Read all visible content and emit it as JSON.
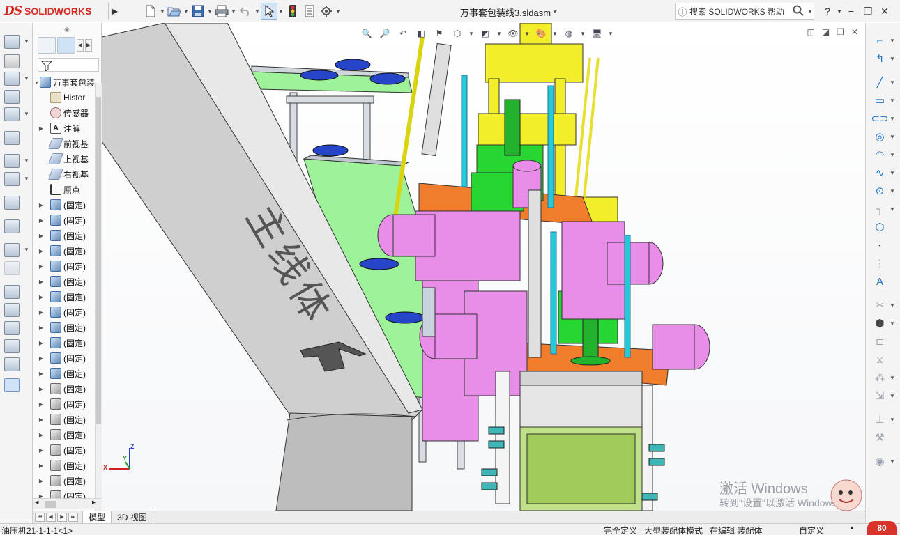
{
  "app": {
    "logo_text": "SOLIDWORKS",
    "logo_ds": "DS",
    "document_title": "万事套包装线3.sldasm *",
    "search_placeholder": "搜索 SOLIDWORKS 帮助",
    "help_label": "?",
    "expand_arrow": "▶"
  },
  "toolbar": {
    "icons": [
      "new-document-icon",
      "open-icon",
      "save-icon",
      "print-icon",
      "undo-icon",
      "select-icon",
      "rebuild-traffic-light-icon",
      "file-properties-icon",
      "options-gear-icon"
    ]
  },
  "feature_tree": {
    "root_label": "万事套包装",
    "items": [
      {
        "label": "Histor",
        "icon": "history-icon",
        "expand": ""
      },
      {
        "label": "传感器",
        "icon": "sensor-icon",
        "expand": ""
      },
      {
        "label": "注解",
        "icon": "annotation-icon",
        "expand": "▶"
      },
      {
        "label": "前视基",
        "icon": "plane-icon",
        "expand": ""
      },
      {
        "label": "上视基",
        "icon": "plane-icon",
        "expand": ""
      },
      {
        "label": "右视基",
        "icon": "plane-icon",
        "expand": ""
      },
      {
        "label": "原点",
        "icon": "origin-icon",
        "expand": ""
      },
      {
        "label": "(固定)",
        "icon": "part-icon",
        "expand": "▶"
      },
      {
        "label": "(固定)",
        "icon": "part-icon",
        "expand": "▶"
      },
      {
        "label": "(固定)",
        "icon": "part-icon",
        "expand": "▶"
      },
      {
        "label": "(固定)",
        "icon": "part-icon",
        "expand": "▶"
      },
      {
        "label": "(固定)",
        "icon": "part-icon",
        "expand": "▶"
      },
      {
        "label": "(固定)",
        "icon": "part-icon",
        "expand": "▶"
      },
      {
        "label": "(固定)",
        "icon": "part-icon",
        "expand": "▶"
      },
      {
        "label": "(固定)",
        "icon": "part-icon",
        "expand": "▶"
      },
      {
        "label": "(固定)",
        "icon": "part-icon",
        "expand": "▶"
      },
      {
        "label": "(固定)",
        "icon": "part-icon",
        "expand": "▶"
      },
      {
        "label": "(固定)",
        "icon": "part-icon",
        "expand": "▶"
      },
      {
        "label": "(固定)",
        "icon": "part-icon",
        "expand": "▶"
      },
      {
        "label": "(固定)",
        "icon": "assembly-icon",
        "expand": "▶"
      },
      {
        "label": "(固定)",
        "icon": "assembly-icon",
        "expand": "▶"
      },
      {
        "label": "(固定)",
        "icon": "assembly-icon",
        "expand": "▶"
      },
      {
        "label": "(固定)",
        "icon": "assembly-icon",
        "expand": "▶"
      },
      {
        "label": "(固定)",
        "icon": "assembly-icon",
        "expand": "▶"
      },
      {
        "label": "(固定)",
        "icon": "assembly-icon",
        "expand": "▶"
      },
      {
        "label": "(固定)",
        "icon": "assembly-icon",
        "expand": "▶"
      },
      {
        "label": "(固定)",
        "icon": "assembly-icon",
        "expand": "▶"
      }
    ]
  },
  "graphics": {
    "conveyor_text": "主线体",
    "watermark_title": "激活 Windows",
    "watermark_sub": "转到\"设置\"以激活 Windows。",
    "axis_x": "X",
    "axis_y": "Y",
    "axis_z": "Z"
  },
  "bottom_tabs": [
    "模型",
    "3D 视图"
  ],
  "status_bar": {
    "selection": "油压机21-1-1-1<1>",
    "definition": "完全定义",
    "mode": "大型装配体模式",
    "editing": "在编辑 装配体",
    "units": "自定义",
    "badge": "80"
  },
  "colors": {
    "brand_red": "#d52b1e",
    "green_conveyor": "#9df29a",
    "magenta_part": "#e98ee8",
    "yellow_part": "#f3ee2a",
    "orange_plate": "#ef7d2b",
    "cyan_rod": "#26c9d6",
    "green_cylinder": "#23b22b",
    "blue_cup": "#2745c9"
  }
}
